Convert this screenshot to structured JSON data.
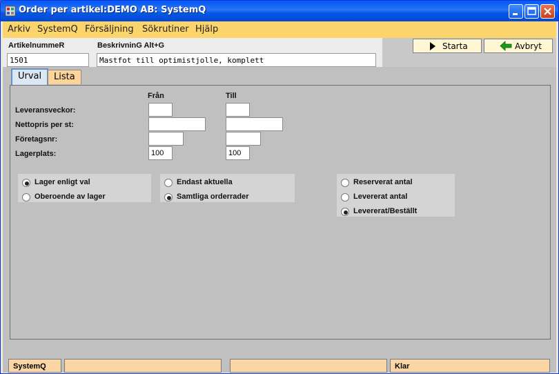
{
  "window": {
    "title": "Order per artikel:DEMO AB: SystemQ",
    "app_icon": "systemq-app-icon",
    "controls": [
      "minimize-icon",
      "maximize-icon",
      "close-icon"
    ]
  },
  "menu": {
    "items": [
      {
        "label": "Arkiv"
      },
      {
        "label": "SystemQ"
      },
      {
        "label": "Försäljning"
      },
      {
        "label": "Sökrutiner"
      },
      {
        "label": "Hjälp"
      }
    ]
  },
  "header": {
    "article_label": "ArtikelnummeR",
    "article_value": "1501",
    "description_label": "BeskrivninG Alt+G",
    "description_value": "Mastfot till optimistjolle, komplett"
  },
  "toolbar": {
    "start_label": "Starta",
    "start_icon": "play-triangle-icon",
    "cancel_label": "Avbryt",
    "cancel_icon": "arrow-left-icon",
    "start_color": "#000000",
    "cancel_color": "#1a9a1a"
  },
  "tabs": [
    {
      "label": "Urval",
      "active": true
    },
    {
      "label": "Lista",
      "active": false
    }
  ],
  "criteria": {
    "from_header": "Från",
    "to_header": "Till",
    "rows": [
      {
        "label": "Leveransveckor:",
        "from": "",
        "to": ""
      },
      {
        "label": "Nettopris per st:",
        "from": "",
        "to": ""
      },
      {
        "label": "Företagsnr:",
        "from": "",
        "to": ""
      },
      {
        "label": "Lagerplats:",
        "from": "100",
        "to": "100"
      }
    ]
  },
  "radio_groups": {
    "stock": {
      "options": [
        {
          "label": "Lager enligt val",
          "checked": true
        },
        {
          "label": "Oberoende av lager",
          "checked": false
        }
      ]
    },
    "rows": {
      "options": [
        {
          "label": "Endast aktuella",
          "checked": false
        },
        {
          "label": "Samtliga orderrader",
          "checked": true
        }
      ]
    },
    "quantity": {
      "options": [
        {
          "label": "Reserverat antal",
          "checked": false
        },
        {
          "label": "Levererat antal",
          "checked": false
        },
        {
          "label": "Levererat/Beställt",
          "checked": true
        }
      ]
    }
  },
  "status": {
    "app": "SystemQ",
    "field2": "",
    "field3": "",
    "state": "Klar"
  }
}
